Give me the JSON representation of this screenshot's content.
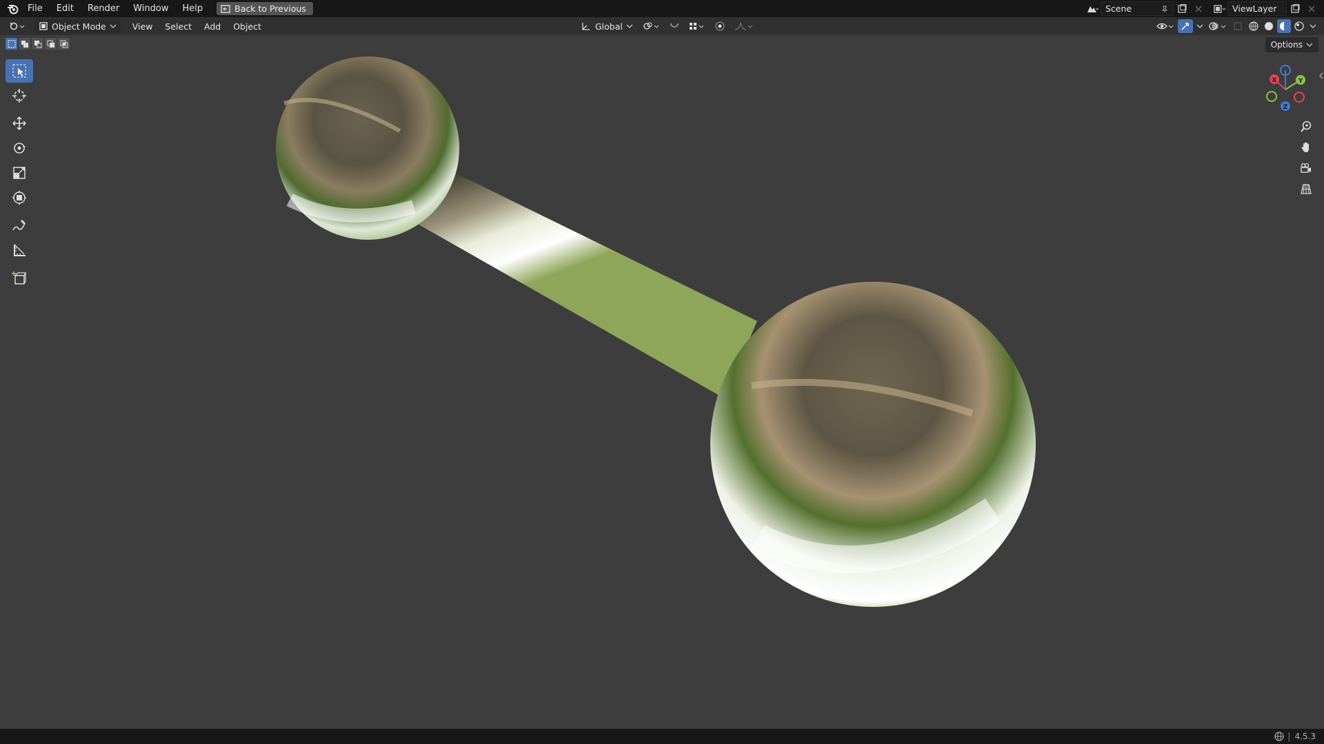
{
  "topbar": {
    "menus": [
      "File",
      "Edit",
      "Render",
      "Window",
      "Help"
    ],
    "back_button": "Back to Previous",
    "scene_name": "Scene",
    "view_layer": "ViewLayer"
  },
  "header": {
    "mode": "Object Mode",
    "menus": [
      "View",
      "Select",
      "Add",
      "Object"
    ],
    "transform_orientation": "Global"
  },
  "viewport": {
    "options_label": "Options",
    "gizmo_axes": [
      "X",
      "Y",
      "Z"
    ]
  },
  "status": {
    "version": "4.5.3"
  },
  "colors": {
    "accent": "#4772b3",
    "axis_x": "#e0445a",
    "axis_y": "#8bc34a",
    "axis_z": "#3d7ad8"
  }
}
